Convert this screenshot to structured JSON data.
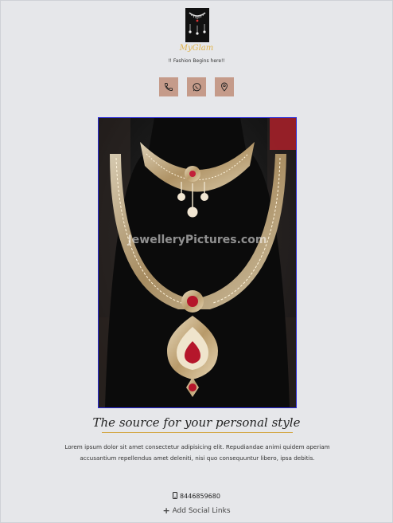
{
  "header": {
    "brand_name": "MyGlam",
    "tagline": "!! Fashion Begins here!!",
    "logo_icon": "earrings-logo-icon"
  },
  "contact_icons": [
    {
      "icon": "phone-icon"
    },
    {
      "icon": "whatsapp-icon"
    },
    {
      "icon": "location-pin-icon"
    }
  ],
  "hero": {
    "watermark": "JewelleryPictures.com"
  },
  "content": {
    "heading": "The source for your personal style",
    "description": "Lorem ipsum dolor sit amet consectetur adipisicing elit. Repudiandae animi quidem aperiam accusantium repellendus amet deleniti, nisi quo consequuntur libero, ipsa debitis."
  },
  "footer": {
    "phone_icon": "mobile-phone-icon",
    "phone": "8446859680",
    "add_social_label": "Add Social Links",
    "add_icon": "plus-icon"
  },
  "colors": {
    "background": "#e6e7ea",
    "icon_button": "#c59b8a",
    "brand_gold": "#e0b34a",
    "hero_border": "#2b2bd8"
  }
}
